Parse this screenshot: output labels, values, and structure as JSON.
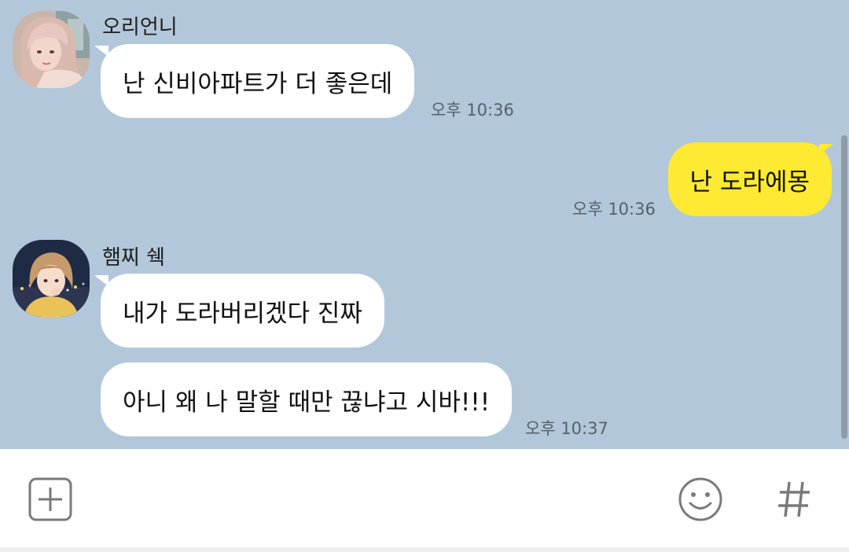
{
  "messages": [
    {
      "sender": "오리언니",
      "text": "난 신비아파트가 더 좋은데",
      "time": "오후 10:36"
    },
    {
      "sender": "me",
      "text": "난 도라에몽",
      "time": "오후 10:36"
    },
    {
      "sender": "햄찌 쉑",
      "text": "내가 도라버리겠다 진짜",
      "time": ""
    },
    {
      "sender": "햄찌 쉑",
      "text": "아니 왜 나 말할 때만 끊냐고 시바!!!",
      "time": "오후 10:37"
    }
  ],
  "input_bar": {
    "add_icon": "plus-box-icon",
    "emoji_icon": "smiley-icon",
    "hash_icon": "hash-icon"
  },
  "colors": {
    "chat_background": "#b2c7da",
    "my_bubble": "#fee933",
    "other_bubble": "#ffffff"
  }
}
